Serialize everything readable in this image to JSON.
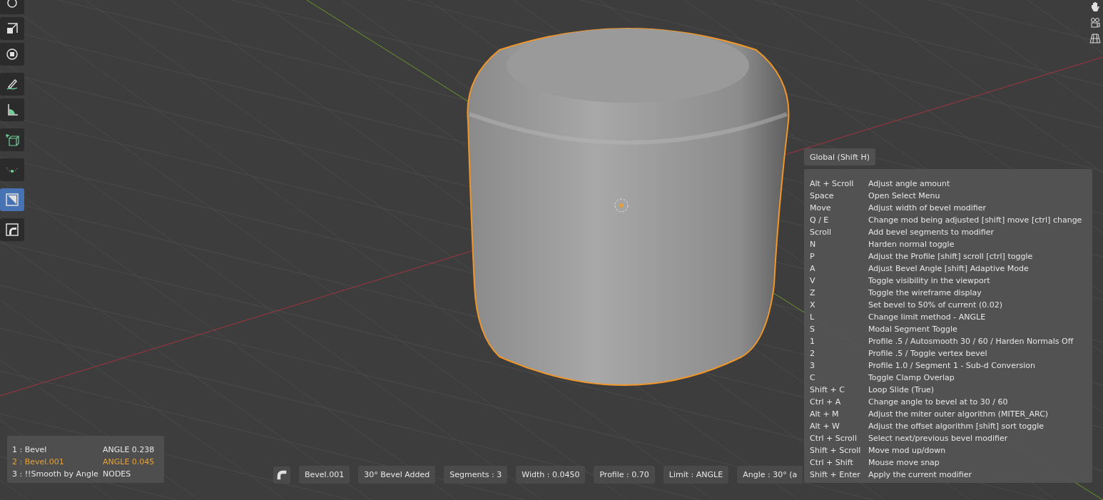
{
  "toolbar": {
    "tools": [
      {
        "selected": false
      },
      {
        "selected": false
      },
      {
        "selected": false
      },
      {
        "selected": false
      },
      {
        "selected": false
      },
      {
        "selected": false
      },
      {
        "selected": false
      },
      {
        "selected": true
      },
      {
        "selected": false
      }
    ]
  },
  "help": {
    "title": "Global (Shift H)",
    "rows": [
      {
        "key": "Alt + Scroll",
        "action": "Adjust angle amount"
      },
      {
        "key": "Space",
        "action": "Open Select Menu"
      },
      {
        "key": "Move",
        "action": "Adjust width of bevel modifier"
      },
      {
        "key": "Q / E",
        "action": "Change mod being adjusted [shift] move [ctrl] change"
      },
      {
        "key": "Scroll",
        "action": "Add bevel segments to modifier"
      },
      {
        "key": "N",
        "action": "Harden normal toggle"
      },
      {
        "key": "P",
        "action": "Adjust the Profile [shift] scroll [ctrl] toggle"
      },
      {
        "key": "A",
        "action": "Adjust Bevel Angle [shift] Adaptive Mode"
      },
      {
        "key": "V",
        "action": "Toggle visibility in the viewport"
      },
      {
        "key": "Z",
        "action": "Toggle the wireframe display"
      },
      {
        "key": "X",
        "action": "Set bevel to 50% of current (0.02)"
      },
      {
        "key": "L",
        "action": "Change limit method - ANGLE"
      },
      {
        "key": "S",
        "action": "Modal Segment Toggle"
      },
      {
        "key": "1",
        "action": "Profile .5 / Autosmooth 30 / 60 / Harden Normals Off"
      },
      {
        "key": "2",
        "action": "Profile .5 / Toggle vertex bevel"
      },
      {
        "key": "3",
        "action": "Profile 1.0 / Segment 1 - Sub-d Conversion"
      },
      {
        "key": "C",
        "action": "Toggle Clamp Overlap"
      },
      {
        "key": "Shift + C",
        "action": "Loop Slide (True)"
      },
      {
        "key": "Ctrl + A",
        "action": "Change angle to bevel at to 30 / 60"
      },
      {
        "key": "Alt + M",
        "action": "Adjust the miter outer algorithm (MITER_ARC)"
      },
      {
        "key": "Alt + W",
        "action": "Adjust the offset algorithm [shift] sort toggle"
      },
      {
        "key": "Ctrl + Scroll",
        "action": "Select next/previous bevel modifier"
      },
      {
        "key": "Shift + Scroll",
        "action": "Move mod up/down"
      },
      {
        "key": "Ctrl + Shift",
        "action": "Mouse move snap"
      },
      {
        "key": "Shift + Enter",
        "action": "Apply the current modifier"
      }
    ]
  },
  "modifiers": [
    {
      "name": "1 : Bevel",
      "value": "ANGLE 0.238",
      "selected": false
    },
    {
      "name": "2 : Bevel.001",
      "value": "ANGLE 0.045",
      "selected": true
    },
    {
      "name": "3 : !!Smooth by Angle",
      "value": "NODES",
      "selected": false
    }
  ],
  "status_bar": [
    "Bevel.001",
    "30° Bevel Added",
    "Segments : 3",
    "Width : 0.0450",
    "Profile : 0.70",
    "Limit : ANGLE",
    "Angle : 30° (a"
  ]
}
